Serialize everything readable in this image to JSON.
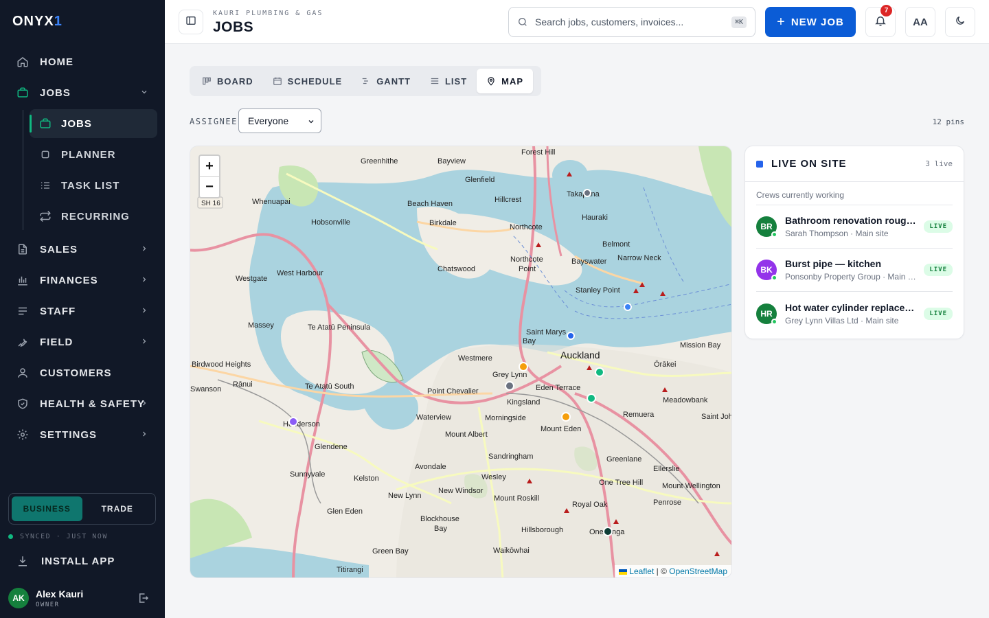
{
  "app": {
    "logo_text": "ONYX",
    "logo_accent": "1",
    "accent_color": "#0b5cd6"
  },
  "sidebar": {
    "items": [
      {
        "label": "HOME",
        "icon": "home-icon"
      },
      {
        "label": "JOBS",
        "icon": "briefcase-icon",
        "expanded": true
      },
      {
        "label": "SALES",
        "icon": "document-icon"
      },
      {
        "label": "FINANCES",
        "icon": "bar-chart-icon"
      },
      {
        "label": "STAFF",
        "icon": "list-icon"
      },
      {
        "label": "FIELD",
        "icon": "wrench-icon"
      },
      {
        "label": "CUSTOMERS",
        "icon": "user-icon"
      },
      {
        "label": "HEALTH & SAFETY",
        "icon": "shield-icon"
      },
      {
        "label": "SETTINGS",
        "icon": "gear-icon"
      }
    ],
    "jobs_sub": [
      {
        "label": "JOBS",
        "icon": "briefcase-icon",
        "active": true
      },
      {
        "label": "PLANNER",
        "icon": "square-icon"
      },
      {
        "label": "TASK LIST",
        "icon": "checklist-icon"
      },
      {
        "label": "RECURRING",
        "icon": "repeat-icon"
      }
    ],
    "mode": {
      "options": [
        "BUSINESS",
        "TRADE"
      ],
      "selected": "BUSINESS"
    },
    "sync_status": "SYNCED · JUST NOW",
    "install_label": "INSTALL APP",
    "user": {
      "initials": "AK",
      "name": "Alex Kauri",
      "role": "OWNER"
    }
  },
  "header": {
    "org_name": "KAURI PLUMBING & GAS",
    "title": "JOBS",
    "search_placeholder": "Search jobs, customers, invoices...",
    "search_shortcut": "⌘K",
    "new_job_label": "NEW JOB",
    "notification_count": "7",
    "font_size_label": "AA"
  },
  "views": {
    "tabs": [
      {
        "label": "BOARD",
        "icon": "board-icon"
      },
      {
        "label": "SCHEDULE",
        "icon": "calendar-icon"
      },
      {
        "label": "GANTT",
        "icon": "gantt-icon"
      },
      {
        "label": "LIST",
        "icon": "list-icon"
      },
      {
        "label": "MAP",
        "icon": "map-pin-icon",
        "active": true
      }
    ]
  },
  "filter": {
    "label": "ASSIGNEE",
    "value": "Everyone",
    "pins_count": "12 pins"
  },
  "map": {
    "zoom_in": "+",
    "zoom_out": "−",
    "attribution_leaflet": "Leaflet",
    "attribution_sep": " | © ",
    "attribution_osm": "OpenStreetMap",
    "places": [
      "Forest Hill",
      "Greenhithe",
      "Bayview",
      "Glenfield",
      "Hillcrest",
      "Takapuna",
      "Whenuapai",
      "Beach Haven",
      "Hobsonville",
      "Birkdale",
      "Northcote",
      "Hauraki",
      "Belmont",
      "Narrow Neck",
      "Chatswood",
      "Northcote Point",
      "Bayswater",
      "Westgate",
      "West Harbour",
      "Stanley Point",
      "Massey",
      "Te Atatū Peninsula",
      "Saint Marys Bay",
      "Auckland",
      "Mission Bay",
      "Birdwood Heights",
      "Westmere",
      "Grey Lynn",
      "Ōrākei",
      "Rānui",
      "Te Atatū South",
      "Point Chevalier",
      "Eden Terrace",
      "Kingsland",
      "Meadowbank",
      "Henderson",
      "Waterview",
      "Morningside",
      "Remuera",
      "Saint Johns",
      "Mount Albert",
      "Mount Eden",
      "Glendene",
      "Greenlane",
      "Sandringham",
      "Sunnyvale",
      "Avondale",
      "Kelston",
      "Ellerslie",
      "One Tree Hill",
      "Wesley",
      "New Lynn",
      "New Windsor",
      "Mount Wellington",
      "Mount Roskill",
      "Penrose",
      "Glen Eden",
      "Royal Oak",
      "Blockhouse Bay",
      "Hillsborough",
      "Onehunga",
      "Green Bay",
      "Waikōwhai",
      "Titirangi",
      "Swanson",
      "SH 16"
    ],
    "pins": [
      {
        "color": "#6b7280"
      },
      {
        "color": "#3b82f6"
      },
      {
        "color": "#2563eb"
      },
      {
        "color": "#f59e0b"
      },
      {
        "color": "#6b7280"
      },
      {
        "color": "#10b981"
      },
      {
        "color": "#10b981"
      },
      {
        "color": "#f59e0b"
      },
      {
        "color": "#8b5cf6"
      },
      {
        "color": "#0f3d36"
      }
    ]
  },
  "live_panel": {
    "title": "LIVE ON SITE",
    "count": "3 live",
    "subtitle": "Crews currently working",
    "crews": [
      {
        "initials": "BR",
        "color": "#15803d",
        "job": "Bathroom renovation rough-in",
        "meta": "Sarah Thompson · Main site",
        "status": "LIVE"
      },
      {
        "initials": "BK",
        "color": "#9333ea",
        "job": "Burst pipe — kitchen",
        "meta": "Ponsonby Property Group · Main site",
        "status": "LIVE"
      },
      {
        "initials": "HR",
        "color": "#15803d",
        "job": "Hot water cylinder replacement",
        "meta": "Grey Lynn Villas Ltd · Main site",
        "status": "LIVE"
      }
    ]
  }
}
